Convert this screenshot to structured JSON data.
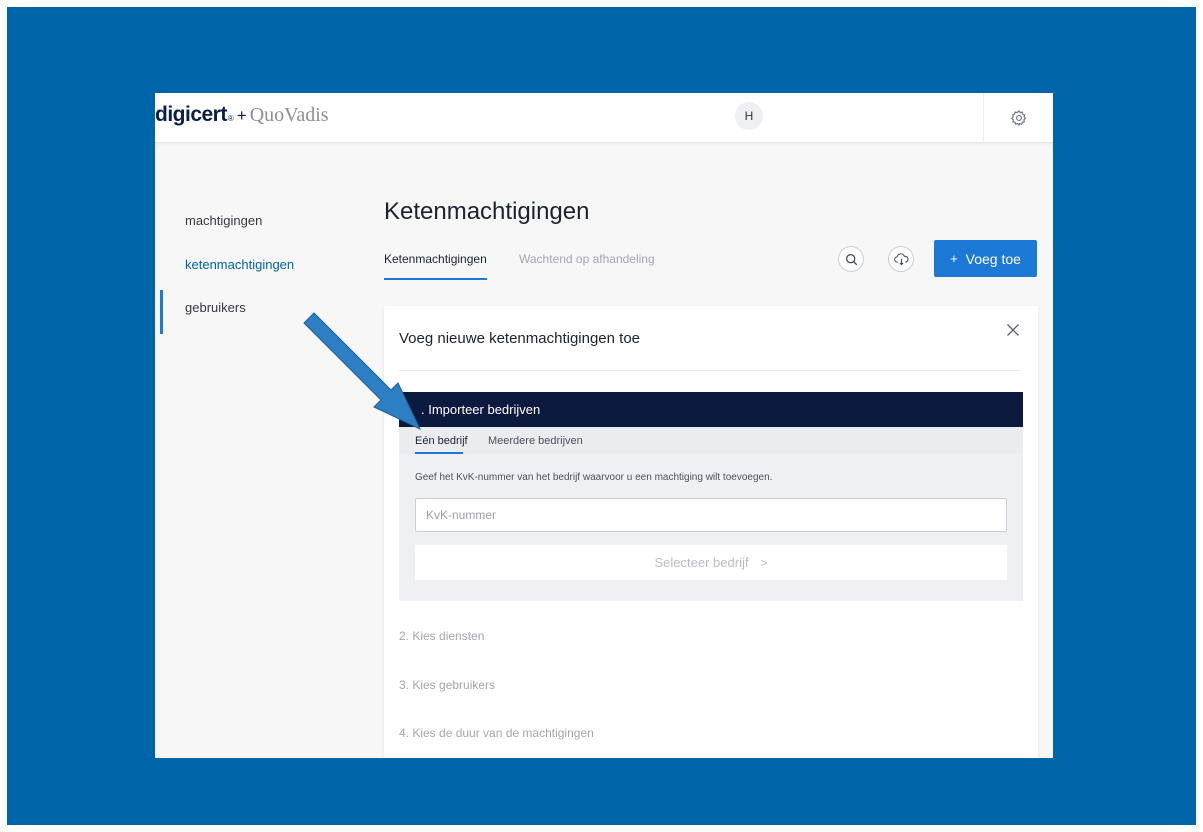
{
  "header": {
    "logo_main": "digicert",
    "logo_reg": "®",
    "logo_plus": "+",
    "logo_partner": "QuoVadis",
    "avatar_initial": "H",
    "settings_icon": "gear-icon"
  },
  "sidebar": {
    "items": [
      {
        "label": "machtigingen"
      },
      {
        "label": "ketenmachtigingen"
      },
      {
        "label": "gebruikers"
      }
    ],
    "active_color": "#0064a8"
  },
  "main": {
    "title": "Ketenmachtigingen",
    "tabs": [
      {
        "label": "Ketenmachtigingen"
      },
      {
        "label": "Wachtend op afhandeling"
      }
    ],
    "search_icon": "search-icon",
    "cloud_icon": "cloud-download-icon",
    "add_button": {
      "plus": "+",
      "label": "Voeg toe"
    }
  },
  "card": {
    "title": "Voeg nieuwe ketenmachtigingen toe",
    "close_icon": "close-icon",
    "step1": {
      "label": ". Importeer bedrijven",
      "subtabs": [
        {
          "label": "Eén bedrijf"
        },
        {
          "label": "Meerdere bedrijven"
        }
      ],
      "instruction": "Geef het KvK-nummer van het bedrijf waarvoor u een machtiging wilt toevoegen.",
      "input_placeholder": "KvK-nummer",
      "input_value": "",
      "select_button": {
        "label": "Selecteer bedrijf",
        "chevron": ">"
      }
    },
    "steps": [
      {
        "label": "2. Kies diensten"
      },
      {
        "label": "3. Kies gebruikers"
      },
      {
        "label": "4. Kies de duur van de machtigingen"
      }
    ]
  },
  "colors": {
    "frame_blue": "#0064a8",
    "accent": "#1c7ad6",
    "step_header": "#0d1a40",
    "arrow": "#2d7fc4"
  }
}
